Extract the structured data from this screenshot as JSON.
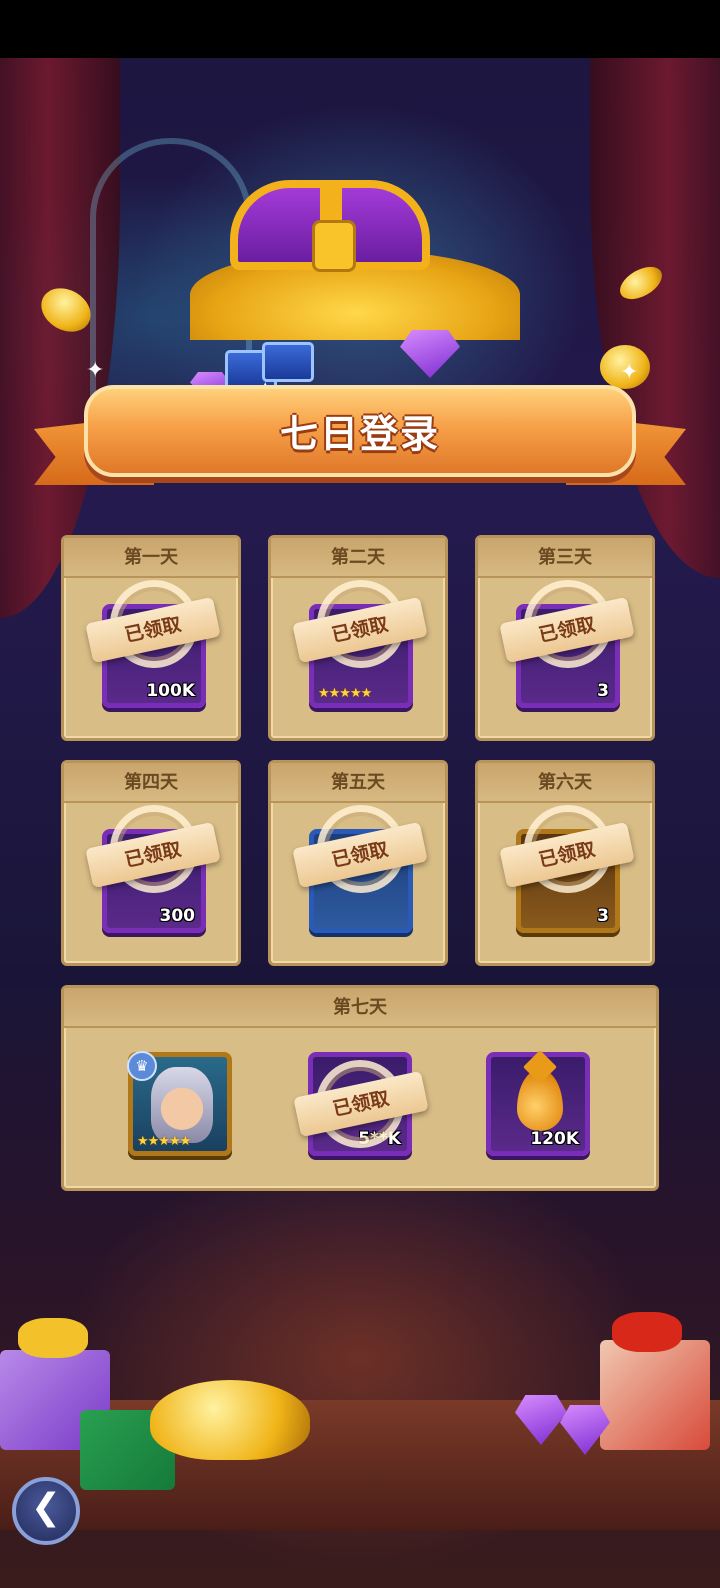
{
  "title": "七日登录",
  "days": [
    {
      "label": "第一天",
      "qty": "100K",
      "claimed": "已领取"
    },
    {
      "label": "第二天",
      "stars": "★★★★★",
      "claimed": "已领取"
    },
    {
      "label": "第三天",
      "qty": "3",
      "claimed": "已领取"
    },
    {
      "label": "第四天",
      "qty": "300",
      "claimed": "已领取"
    },
    {
      "label": "第五天",
      "claimed": "已领取"
    },
    {
      "label": "第六天",
      "qty": "3",
      "claimed": "已领取"
    }
  ],
  "day7": {
    "label": "第七天",
    "rewards": [
      {
        "type": "hero",
        "stars": "★★★★★"
      },
      {
        "type": "coins",
        "qty": "5**K",
        "claimed": "已领取"
      },
      {
        "type": "elixir",
        "qty": "120K"
      }
    ]
  },
  "icons": {
    "back": "back-arrow-icon",
    "crown": "crown-icon"
  },
  "colors": {
    "ribbon": "#f6a048",
    "card": "#d9bd86",
    "purple_frame": "#7a2eb8"
  }
}
